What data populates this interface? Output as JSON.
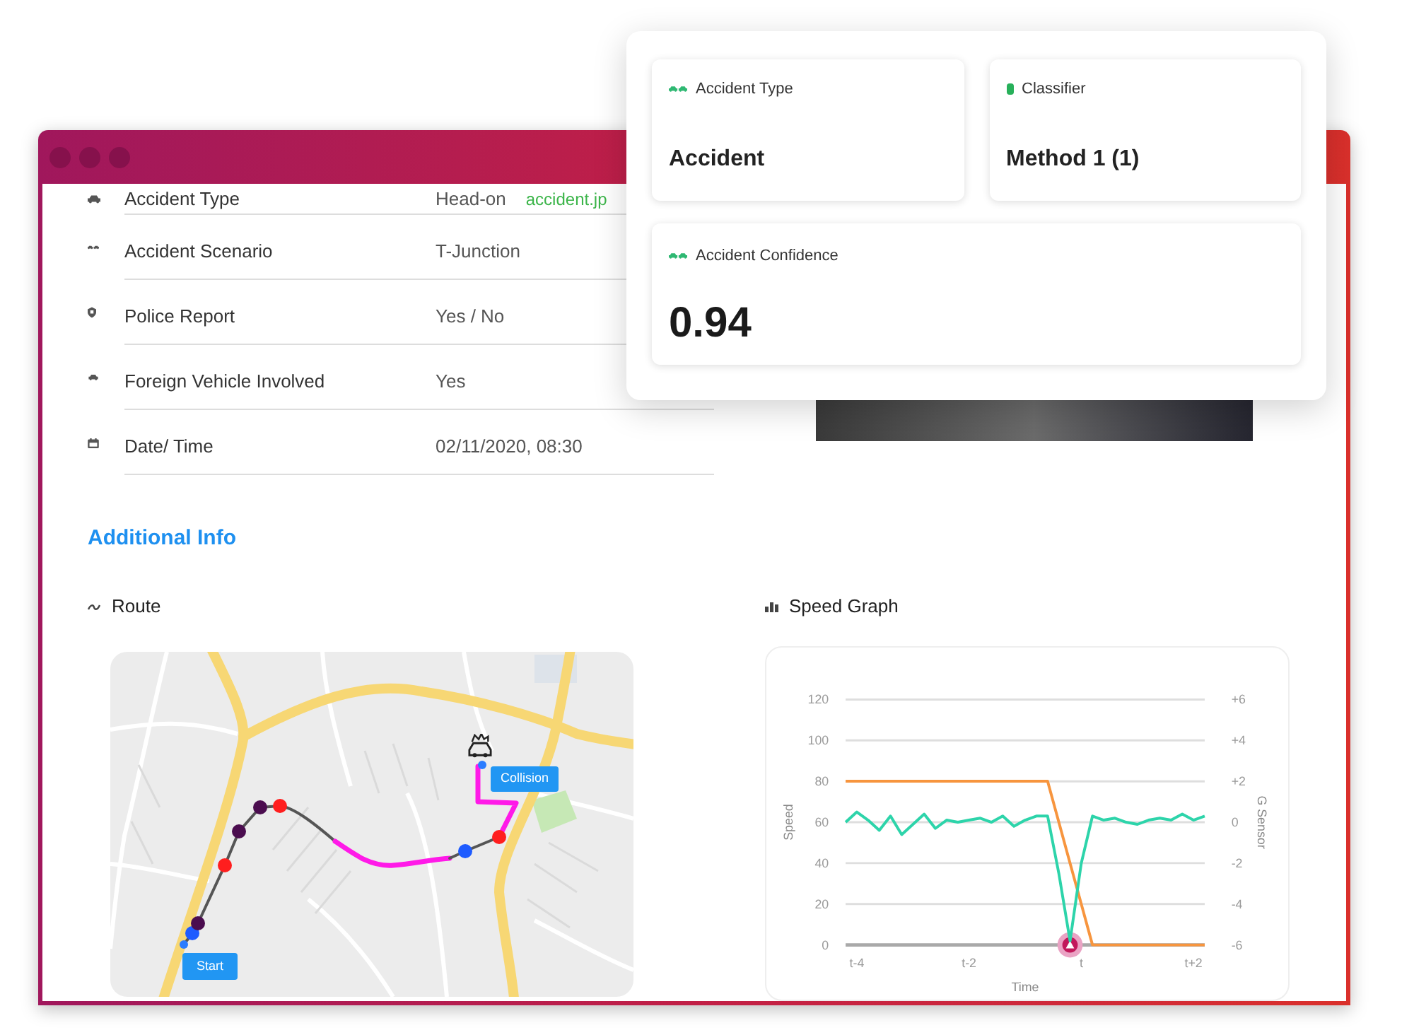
{
  "details": {
    "rows": [
      {
        "label": "Accident Type",
        "value": "Head-on",
        "link": "accident.jp"
      },
      {
        "label": "Accident Scenario",
        "value": "T-Junction"
      },
      {
        "label": "Police Report",
        "value": "Yes / No"
      },
      {
        "label": "Foreign Vehicle Involved",
        "value": "Yes"
      },
      {
        "label": "Date/ Time",
        "value": "02/11/2020, 08:30"
      }
    ]
  },
  "summary_popup": {
    "cards": [
      {
        "kind": "text",
        "label": "Accident Type",
        "value": "Accident"
      },
      {
        "kind": "text",
        "label": "Classifier",
        "value": "Method 1 (1)"
      },
      {
        "kind": "score",
        "label": "Accident Confidence",
        "value": "0.94"
      }
    ]
  },
  "additional_info": {
    "title": "Additional Info",
    "route": {
      "title": "Route",
      "start_label": "Start",
      "end_label": "Collision"
    },
    "speed_graph": {
      "title": "Speed Graph",
      "collision_marker": true,
      "chart_data": {
        "type": "line",
        "xlabel": "Time",
        "ylabel": "Speed",
        "y2label": "G Sensor",
        "grid": true,
        "categories": [
          null,
          "t-4",
          null,
          null,
          null,
          null,
          null,
          null,
          null,
          null,
          null,
          "t-2",
          null,
          null,
          null,
          null,
          null,
          null,
          null,
          null,
          null,
          "t",
          null,
          null,
          null,
          null,
          null,
          null,
          null,
          null,
          null,
          "t+2",
          null
        ],
        "series": [
          {
            "color": "#f7953e",
            "values": [
              80,
              80,
              80,
              80,
              80,
              80,
              80,
              80,
              80,
              80,
              80,
              80,
              80,
              80,
              80,
              80,
              80,
              80,
              80,
              60,
              40,
              20,
              0,
              0,
              0,
              0,
              0,
              0,
              0,
              0,
              0,
              0,
              0
            ]
          },
          {
            "color": "#2dd4aa",
            "axis": "y2",
            "values": [
              0,
              0.5,
              0.1,
              -0.4,
              0.3,
              -0.6,
              -0.1,
              0.4,
              -0.3,
              0.1,
              0,
              0.1,
              0.2,
              0,
              0.3,
              -0.2,
              0.1,
              0.3,
              0.3,
              -2.5,
              -5.8,
              -2.0,
              0.3,
              0.1,
              0.2,
              0,
              -0.1,
              0.1,
              0.2,
              0.1,
              0.4,
              0.1,
              0.3
            ]
          }
        ],
        "ylim": [
          0,
          120
        ],
        "y2lim": [
          -6,
          6
        ],
        "yticks": [
          0,
          20,
          40,
          60,
          80,
          100,
          120
        ],
        "y2ticks": [
          {
            "value": -6,
            "label": "-6"
          },
          {
            "value": -4,
            "label": "-4"
          },
          {
            "value": -2,
            "label": "-2"
          },
          {
            "value": 0,
            "label": "0"
          },
          {
            "value": 2,
            "label": "+2"
          },
          {
            "value": 4,
            "label": "+4"
          },
          {
            "value": 6,
            "label": "+6"
          }
        ]
      }
    }
  }
}
